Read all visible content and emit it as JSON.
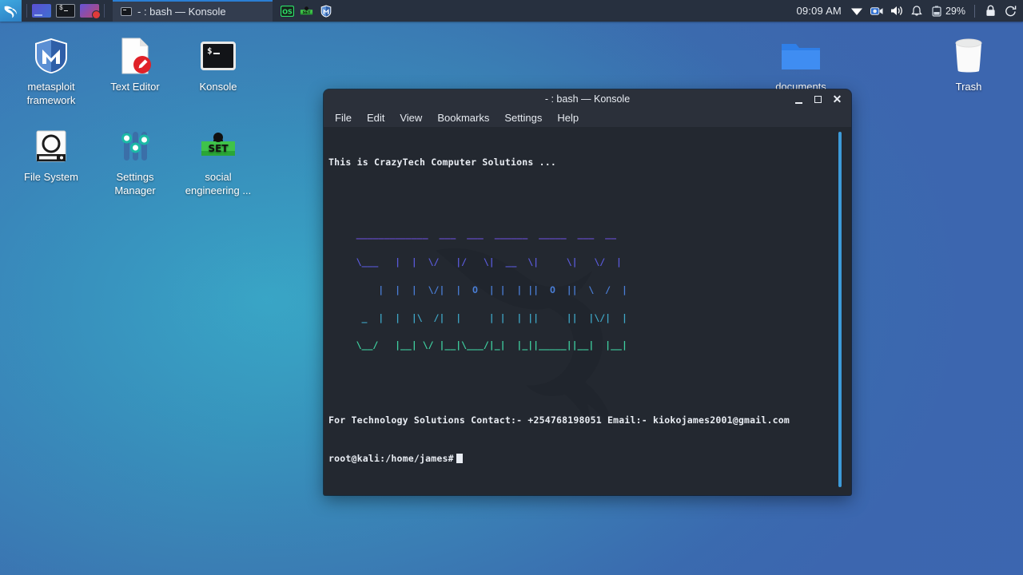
{
  "panel": {
    "start_button": "Kali Menu",
    "launchers": [
      {
        "name": "window-switcher",
        "label": "Window Switcher"
      },
      {
        "name": "terminal-launcher",
        "label": "Terminal"
      },
      {
        "name": "screen-recorder-launcher",
        "label": "Screen Recorder"
      }
    ],
    "task_button": {
      "title": "- : bash — Konsole",
      "icon": "terminal-icon"
    },
    "tray_apps": [
      {
        "name": "os-badge-icon",
        "label": "OS"
      },
      {
        "name": "set-toolkit-icon",
        "label": "SET"
      },
      {
        "name": "metasploit-icon",
        "label": "M"
      }
    ],
    "clock": "09:09 AM",
    "status_icons": [
      {
        "name": "wifi-icon",
        "label": "Network"
      },
      {
        "name": "camera-icon",
        "label": "Camera"
      },
      {
        "name": "volume-icon",
        "label": "Volume"
      },
      {
        "name": "notification-bell-icon",
        "label": "Notifications"
      },
      {
        "name": "battery-icon",
        "label": "Battery"
      }
    ],
    "battery": "29%",
    "lock_icon": "lock-icon",
    "logout_icon": "logout-icon"
  },
  "desktop": {
    "icons": [
      {
        "name": "metasploit-framework",
        "label": "metasploit\nframework",
        "icon": "metasploit-shield-icon"
      },
      {
        "name": "text-editor",
        "label": "Text Editor",
        "icon": "document-pencil-icon"
      },
      {
        "name": "konsole",
        "label": "Konsole",
        "icon": "terminal-icon"
      },
      {
        "name": "documents",
        "label": "documents",
        "icon": "folder-icon"
      },
      {
        "name": "trash",
        "label": "Trash",
        "icon": "trash-bin-icon"
      },
      {
        "name": "file-system",
        "label": "File System",
        "icon": "hard-drive-icon"
      },
      {
        "name": "settings-manager",
        "label": "Settings\nManager",
        "icon": "sliders-icon"
      },
      {
        "name": "social-engineering",
        "label": "social\nengineering ...",
        "icon": "set-toolkit-icon"
      }
    ]
  },
  "konsole": {
    "title": "- : bash — Konsole",
    "window_buttons": {
      "minimize": "minimize-button",
      "maximize": "maximize-button",
      "close": "close-button"
    },
    "menu": [
      "File",
      "Edit",
      "View",
      "Bookmarks",
      "Settings",
      "Help"
    ],
    "terminal": {
      "header_line": "This is CrazyTech Computer Solutions ...",
      "banner_text": "JMOH",
      "banner_lines": [
        "     _____________  ___  ___  ______  _____  ___  __",
        "     \\___   |  |  \\/   |/   \\|  __  \\|     \\|   \\/  |",
        "         |  |  |  \\/|  |  O  | |  | ||  O  ||  \\  /  |",
        "      _  |  |  |\\  /|  |     | |  | ||     ||  |\\/|  |",
        "     \\__/   |__| \\/ |__|\\___/|_|  |_||_____||__|  |__|"
      ],
      "contact_line": "For Technology Solutions Contact:- +254768198051 Email:- kiokojames2001@gmail.com",
      "prompt": "root@kali:/home/james#",
      "cursor": "block-cursor"
    },
    "scrollbar": {
      "name": "vertical-scrollbar",
      "color": "#3d9ad8"
    }
  },
  "colors": {
    "panel_bg": "#27303f",
    "task_highlight": "#2a7fd4",
    "terminal_bg": "#232830",
    "titlebar_bg": "#2b303a",
    "desktop_teal": "#39a7c6",
    "desktop_blue": "#3d66ae",
    "banner_start": "#6a4fd6",
    "banner_end": "#3fd0a0"
  }
}
